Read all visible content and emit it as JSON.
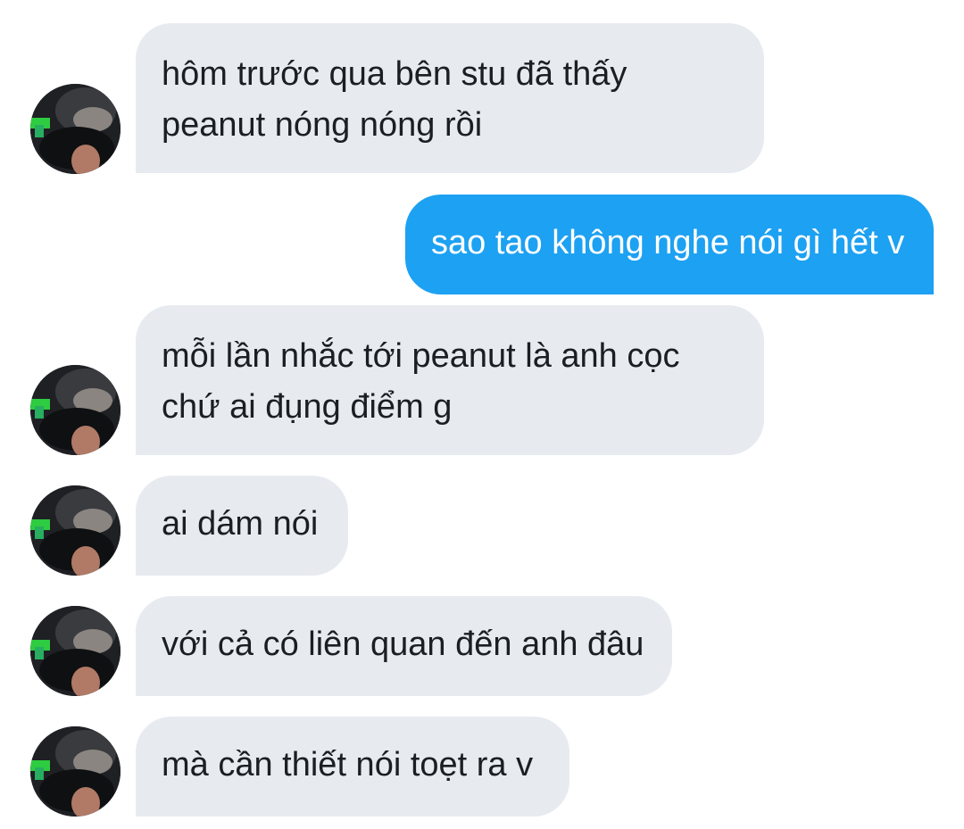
{
  "conversation": {
    "messages": [
      {
        "direction": "incoming",
        "text": "hôm trước qua bên stu đã thấy\npeanut nóng nóng rồi",
        "avatar": "contact-avatar"
      },
      {
        "direction": "outgoing",
        "text": "sao tao không nghe nói gì hết v"
      },
      {
        "direction": "incoming",
        "text": "mỗi lần nhắc tới peanut là anh cọc\nchứ ai đụng điểm g",
        "avatar": "contact-avatar"
      },
      {
        "direction": "incoming",
        "text": "ai dám nói",
        "avatar": "contact-avatar"
      },
      {
        "direction": "incoming",
        "text": "với cả có liên quan đến anh đâu",
        "avatar": "contact-avatar"
      },
      {
        "direction": "incoming",
        "text": "mà cần thiết nói toẹt ra v",
        "avatar": "contact-avatar"
      }
    ]
  },
  "colors": {
    "incoming_bubble": "#e7ebf0",
    "outgoing_bubble": "#1da1f2",
    "incoming_text": "#1b1e22",
    "outgoing_text": "#ffffff"
  }
}
